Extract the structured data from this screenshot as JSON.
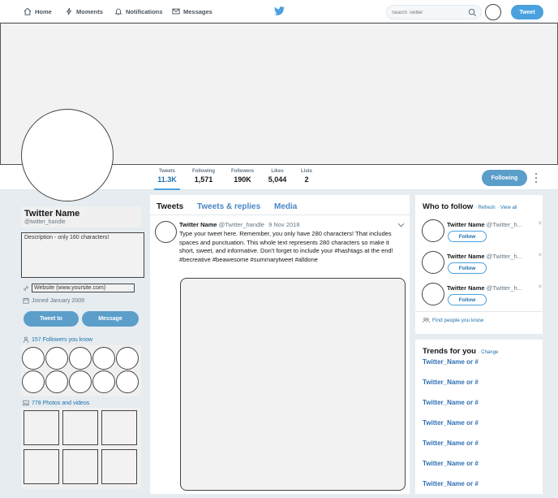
{
  "nav": {
    "home": "Home",
    "moments": "Moments",
    "notifications": "Notifications",
    "messages": "Messages",
    "search_placeholder": "Search Twitter",
    "tweet_button": "Tweet"
  },
  "stats": [
    {
      "label": "Tweets",
      "value": "11.3K"
    },
    {
      "label": "Following",
      "value": "1,571"
    },
    {
      "label": "Followers",
      "value": "190K"
    },
    {
      "label": "Likes",
      "value": "5,044"
    },
    {
      "label": "Lists",
      "value": "2"
    }
  ],
  "following_button": "Following",
  "profile": {
    "name": "Twitter Name",
    "handle": "@twitter_handle",
    "description": "Description - only 160 characters!",
    "website": "Website (www.yoursite.com)",
    "joined": "Joined January 2009",
    "tweet_to": "Tweet to",
    "message": "Message",
    "followers_you_know": "157 Followers you know",
    "photos_videos": "778 Photos and videos"
  },
  "tabs": [
    "Tweets",
    "Tweets & replies",
    "Media"
  ],
  "tweet": {
    "name": "Twitter Name",
    "handle": "@Twitter_handle",
    "date": "9 Nov 2018",
    "text": "Type your tweet here. Remember, you only have 280 characters! That includes spaces and punctuation. This whole text represents 280 characters so make it short, sweet, and informative. Don't forget to include your #hashtags at the end! #becreative #beawesome #summarytweet #alldone"
  },
  "who_to_follow": {
    "title": "Who to follow",
    "refresh": "Refresh",
    "view_all": "View all",
    "items": [
      {
        "name": "Twitter Name",
        "handle": "@Twitter_h..."
      },
      {
        "name": "Twitter Name",
        "handle": "@Twitter_h..."
      },
      {
        "name": "Twitter Name",
        "handle": "@Twitter_h..."
      }
    ],
    "follow_label": "Follow",
    "find_people": "Find people you know"
  },
  "trends": {
    "title": "Trends for you",
    "change": "Change",
    "items": [
      "Twitter_Name or #",
      "Twitter_Name or #",
      "Twitter_Name or #",
      "Twitter_Name or #",
      "Twitter_Name or #",
      "Twitter_Name or #",
      "Twitter_Name or #"
    ]
  },
  "colors": {
    "accent": "#4aa1de",
    "button": "#5b9ec9",
    "link": "#1c6fab",
    "background": "#e6ecf0"
  }
}
